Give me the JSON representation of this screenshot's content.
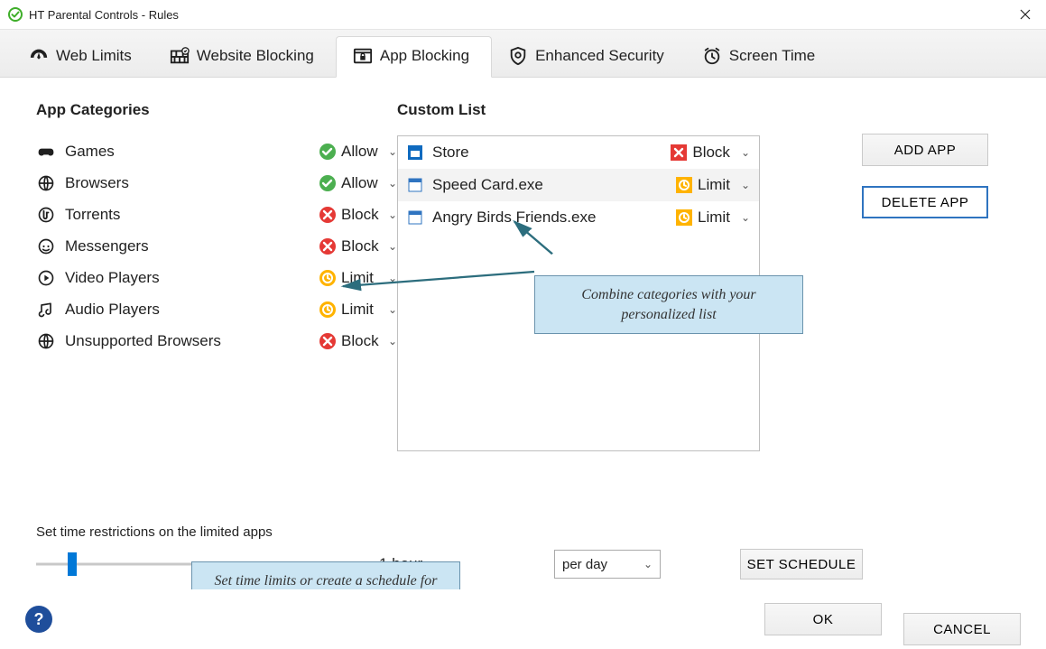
{
  "window": {
    "title": "HT Parental Controls - Rules"
  },
  "tabs": [
    {
      "label": "Web Limits"
    },
    {
      "label": "Website Blocking"
    },
    {
      "label": "App Blocking"
    },
    {
      "label": "Enhanced Security"
    },
    {
      "label": "Screen Time"
    }
  ],
  "active_tab_index": 2,
  "left": {
    "heading": "App Categories",
    "items": [
      {
        "name": "Games",
        "status": "Allow"
      },
      {
        "name": "Browsers",
        "status": "Allow"
      },
      {
        "name": "Torrents",
        "status": "Block"
      },
      {
        "name": "Messengers",
        "status": "Block"
      },
      {
        "name": "Video Players",
        "status": "Limit"
      },
      {
        "name": "Audio Players",
        "status": "Limit"
      },
      {
        "name": "Unsupported Browsers",
        "status": "Block"
      }
    ]
  },
  "custom": {
    "heading": "Custom List",
    "items": [
      {
        "name": "Store",
        "status": "Block"
      },
      {
        "name": "Speed Card.exe",
        "status": "Limit"
      },
      {
        "name": "Angry Birds Friends.exe",
        "status": "Limit"
      }
    ]
  },
  "buttons": {
    "add_app": "ADD APP",
    "delete_app": "DELETE APP",
    "set_schedule": "SET SCHEDULE",
    "ok": "OK",
    "cancel": "CANCEL"
  },
  "restrict": {
    "label": "Set time restrictions on the limited apps",
    "time_value": "1 hour",
    "per_options_selected": "per day"
  },
  "callouts": {
    "c1": "Combine categories with your personalized list",
    "c2": "Set time limits or create a schedule for the limited apps."
  }
}
